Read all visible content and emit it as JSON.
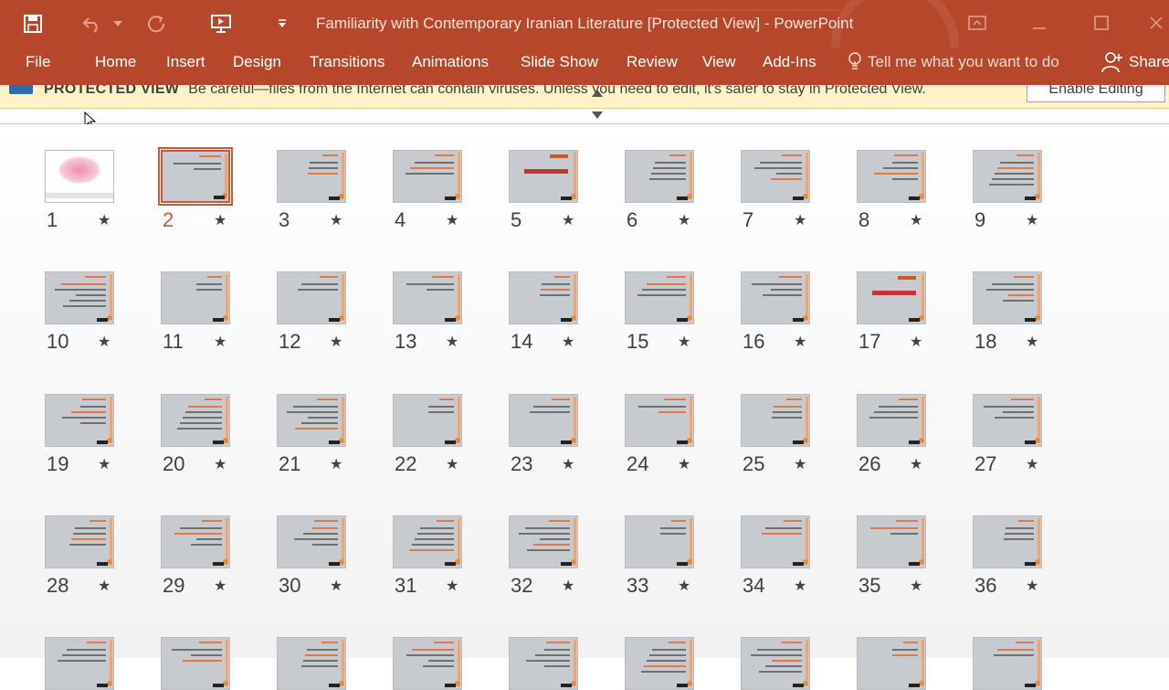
{
  "app": {
    "title": "Familiarity with Contemporary Iranian Literature [Protected View] - PowerPoint",
    "colors": {
      "ribbon": "#b7472a",
      "selected": "#c55a3d",
      "warning": "#fff2c4"
    }
  },
  "qat": [
    {
      "icon": "save-icon"
    },
    {
      "icon": "undo-icon"
    },
    {
      "icon": "undo-dropdown-icon"
    },
    {
      "icon": "redo-icon"
    },
    {
      "icon": "slideshow-from-start-icon"
    },
    {
      "icon": "customize-qat-icon"
    }
  ],
  "window_controls": [
    {
      "icon": "ribbon-display-options-icon"
    },
    {
      "icon": "minimize-icon"
    },
    {
      "icon": "maximize-icon"
    },
    {
      "icon": "close-icon"
    }
  ],
  "menu": {
    "tabs": [
      "File",
      "Home",
      "Insert",
      "Design",
      "Transitions",
      "Animations",
      "Slide Show",
      "Review",
      "View",
      "Add-Ins"
    ],
    "tell_me": "Tell me what you want to do",
    "share": "Share"
  },
  "protected": {
    "label": "PROTECTED VIEW",
    "message": "Be careful—files from the Internet can contain viruses. Unless you need to edit, it's safer to stay in Protected View.",
    "enable_button": "Enable Editing"
  },
  "slides": {
    "selected": 2,
    "numbers": [
      "1",
      "2",
      "3",
      "4",
      "5",
      "6",
      "7",
      "8",
      "9",
      "10",
      "11",
      "12",
      "13",
      "14",
      "15",
      "16",
      "17",
      "18",
      "19",
      "20",
      "21",
      "22",
      "23",
      "24",
      "25",
      "26",
      "27",
      "28",
      "29",
      "30",
      "31",
      "32",
      "33",
      "34",
      "35",
      "36",
      "",
      "",
      "",
      "",
      "",
      "",
      "",
      "",
      ""
    ],
    "star": "★"
  }
}
